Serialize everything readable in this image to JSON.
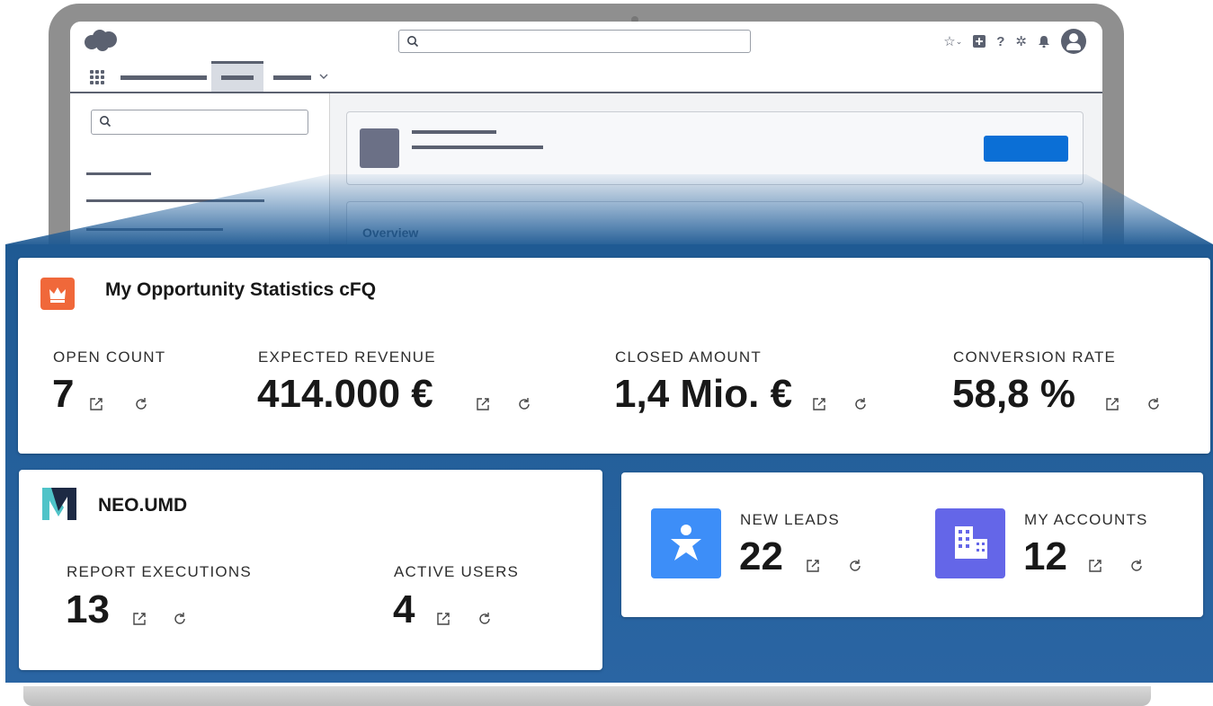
{
  "app": {
    "overview_heading": "Overview",
    "brand_color": "#0b6fd6",
    "panel_color": "#1f5a93"
  },
  "opportunity_card": {
    "title": "My Opportunity Statistics cFQ",
    "icon": "crown-icon",
    "metrics": [
      {
        "label": "OPEN COUNT",
        "value": "7"
      },
      {
        "label": "EXPECTED REVENUE",
        "value": "414.000 €"
      },
      {
        "label": "CLOSED AMOUNT",
        "value": "1,4 Mio. €"
      },
      {
        "label": "CONVERSION RATE",
        "value": "58,8 %"
      }
    ]
  },
  "neo_card": {
    "title": "NEO.UMD",
    "icon": "neo-logo-icon",
    "metrics": [
      {
        "label": "REPORT EXECUTIONS",
        "value": "13"
      },
      {
        "label": "ACTIVE USERS",
        "value": "4"
      }
    ]
  },
  "tiles_card": {
    "tiles": [
      {
        "label": "NEW LEADS",
        "value": "22",
        "icon": "person-icon",
        "color": "#3d8ef8"
      },
      {
        "label": "MY ACCOUNTS",
        "value": "12",
        "icon": "building-icon",
        "color": "#6466e8"
      }
    ]
  }
}
